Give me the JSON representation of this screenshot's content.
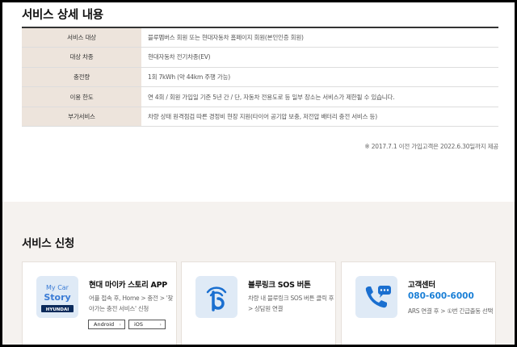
{
  "detail": {
    "title": "서비스 상세 내용",
    "rows": [
      {
        "label": "서비스 대상",
        "value": "블루멤버스 회원 또는 현대자동차 홈페이지 회원(본인인증 회원)"
      },
      {
        "label": "대상 차종",
        "value": "현대자동차 전기차종(EV)"
      },
      {
        "label": "충전량",
        "value": "1회 7kWh (약 44km 주행 가능)"
      },
      {
        "label": "이용 한도",
        "value": "연 4회 / 회원 가입일 기준 5년 간 / 단, 자동차 전용도로 등 일부 장소는 서비스가 제한될 수 있습니다."
      },
      {
        "label": "부가서비스",
        "value": "차량 상태 원격점검 따른 경정비 현장 지원(타이어 공기압 보충, 저전압 배터리 충전 서비스 등)"
      }
    ],
    "footnote": "※ 2017.7.1 이전 가입고객은 2022.6.30일까지 제공"
  },
  "apply": {
    "title": "서비스 신청",
    "cards": [
      {
        "title": "현대 마이카 스토리 APP",
        "desc": "어플 접속 후, Home > 충전 > '찾아가는 충전 서비스' 신청",
        "icon": "mycar-story-app-icon",
        "icon_text_1": "My Car",
        "icon_text_2": "Story",
        "icon_text_3": "HYUNDAI",
        "buttons": [
          "Android",
          "iOS"
        ]
      },
      {
        "title": "블루링크 SOS 버튼",
        "desc": "차량 내 블루링크 SOS 버튼 클릭 후 > 상담원 연결",
        "icon": "bluelink-icon"
      },
      {
        "title": "고객센터",
        "phone": "080-600-6000",
        "desc": "ARS 연결 후 > ①번 긴급출동 선택",
        "icon": "phone-icon"
      }
    ]
  },
  "colors": {
    "header_cell_bg": "#ede4dc",
    "section_bg": "#f5f2ef",
    "phone": "#1a7fd6",
    "icon_bg": "#dfeaf6"
  }
}
